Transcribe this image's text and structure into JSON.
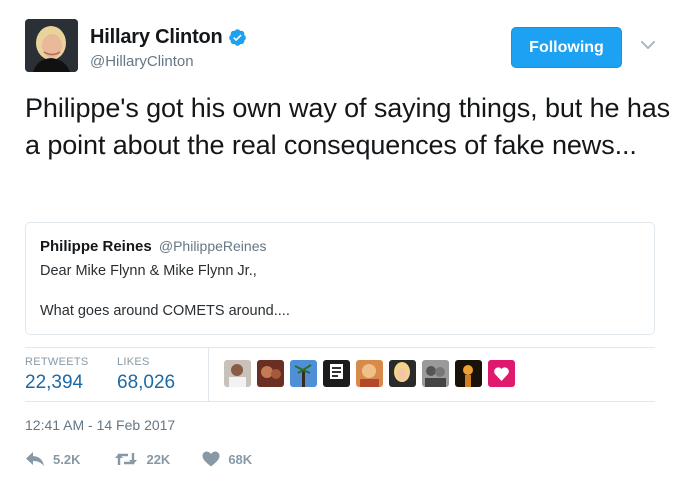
{
  "author": {
    "name": "Hillary Clinton",
    "handle": "@HillaryClinton",
    "verified": true
  },
  "follow_button": {
    "label": "Following"
  },
  "tweet": {
    "text": "Philippe's got his own way of saying things, but he has a point about the real consequences of fake news..."
  },
  "quoted_tweet": {
    "name": "Philippe Reines",
    "handle": "@PhilippeReines",
    "line1": "Dear Mike Flynn & Mike Flynn Jr.,",
    "line2": "What goes around COMETS around...."
  },
  "stats": {
    "retweets_label": "RETWEETS",
    "retweets_value": "22,394",
    "likes_label": "LIKES",
    "likes_value": "68,026"
  },
  "likers_count_shown": 9,
  "timestamp": "12:41 AM - 14 Feb 2017",
  "actions": {
    "reply_count": "5.2K",
    "retweet_count": "22K",
    "like_count": "68K"
  },
  "colors": {
    "accent": "#1da1f2",
    "stat_value": "#1b6aa5",
    "muted": "#657786",
    "action_gray": "#8899a6"
  },
  "icons": [
    "verified-badge-icon",
    "chevron-down-icon",
    "reply-icon",
    "retweet-icon",
    "heart-icon"
  ]
}
